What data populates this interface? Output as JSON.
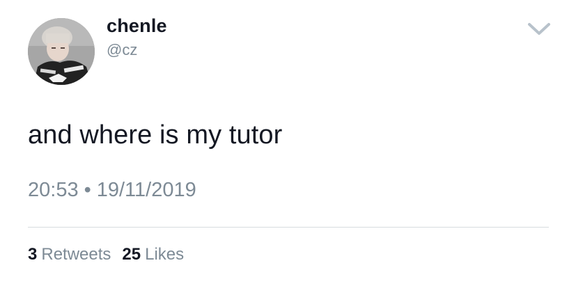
{
  "user": {
    "display_name": "chenle",
    "handle": "@cz"
  },
  "tweet": {
    "text": "and where is my tutor",
    "time": "20:53",
    "separator": "•",
    "date": "19/11/2019"
  },
  "stats": {
    "retweets_count": "3",
    "retweets_label": "Retweets",
    "likes_count": "25",
    "likes_label": "Likes"
  },
  "icons": {
    "menu": "chevron-down-icon",
    "avatar": "profile-photo"
  },
  "colors": {
    "text_primary": "#141823",
    "text_secondary": "#7d8a95",
    "divider": "#d7dbde",
    "chevron": "#b8c2cb"
  }
}
